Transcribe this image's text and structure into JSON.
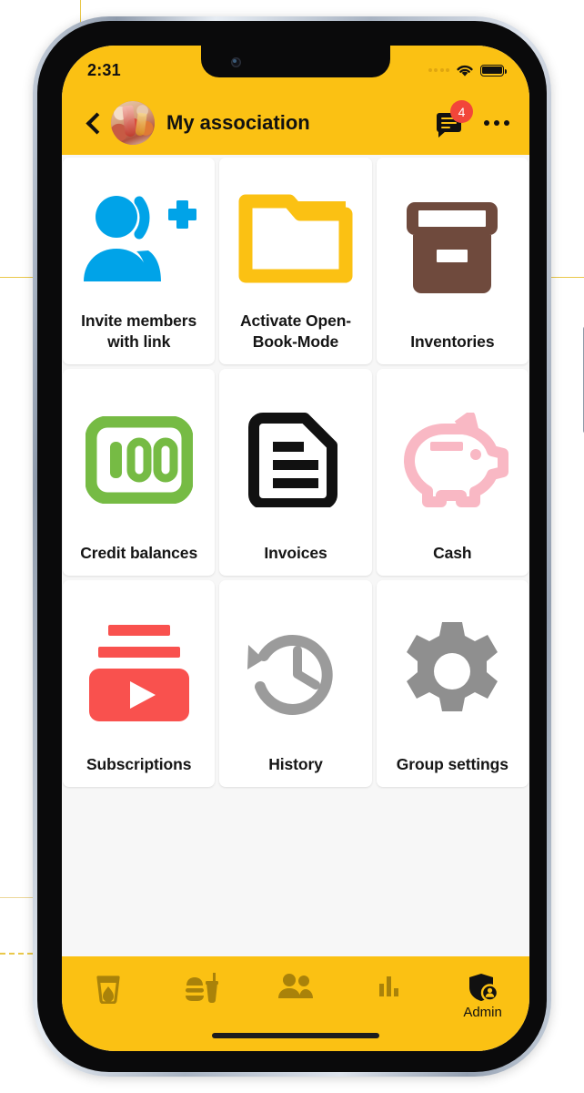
{
  "status_bar": {
    "time": "2:31",
    "signal_icon": "signal-dots-icon",
    "wifi_icon": "wifi-icon",
    "battery_icon": "battery-full-icon"
  },
  "app_bar": {
    "back_icon": "chevron-left-icon",
    "avatar_icon": "group-avatar-image",
    "title": "My association",
    "chat_icon": "chat-bubble-icon",
    "chat_badge": "4",
    "overflow_icon": "more-horizontal-icon"
  },
  "colors": {
    "brand_yellow": "#fbc113",
    "badge_red": "#f2463a",
    "tile_bg": "#ffffff",
    "screen_bg": "#f7f7f7",
    "invite_blue": "#00a3e8",
    "folder_yellow": "#fbc113",
    "inventory_brown": "#6f4a3d",
    "credit_green": "#76bb44",
    "invoice_black": "#111111",
    "cash_pink": "#f9b8c4",
    "subscriptions_red": "#f9514e",
    "history_gray": "#9b9b9b",
    "settings_gray": "#8f8f8f"
  },
  "grid": {
    "tiles": [
      {
        "label": "Invite members with link",
        "icon": "person-add-invite-icon"
      },
      {
        "label": "Activate Open-Book-Mode",
        "icon": "open-folder-icon"
      },
      {
        "label": "Inventories",
        "icon": "archive-box-icon"
      },
      {
        "label": "Credit balances",
        "icon": "credit-100-icon"
      },
      {
        "label": "Invoices",
        "icon": "document-lines-icon"
      },
      {
        "label": "Cash",
        "icon": "piggy-bank-icon"
      },
      {
        "label": "Subscriptions",
        "icon": "video-play-subscriptions-icon"
      },
      {
        "label": "History",
        "icon": "clock-rotate-left-icon"
      },
      {
        "label": "Group settings",
        "icon": "gear-icon"
      }
    ]
  },
  "bottom_nav": {
    "items": [
      {
        "label": "",
        "icon": "drink-glass-icon",
        "active": false
      },
      {
        "label": "",
        "icon": "food-burger-drink-icon",
        "active": false
      },
      {
        "label": "",
        "icon": "people-group-icon",
        "active": false
      },
      {
        "label": "",
        "icon": "bar-chart-icon",
        "active": false
      },
      {
        "label": "Admin",
        "icon": "shield-person-admin-icon",
        "active": true
      }
    ]
  }
}
